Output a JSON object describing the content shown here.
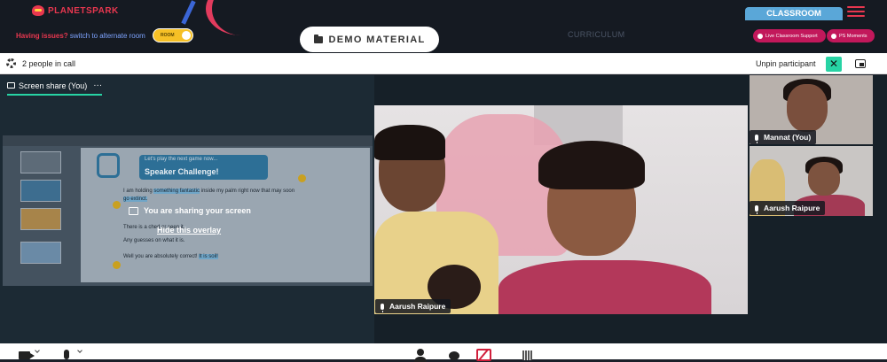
{
  "app": {
    "logo_text": "PLANETSPARK",
    "issue_question": "Having issues?",
    "issue_switch": "switch to alternate room",
    "room_toggle": "ROOM",
    "demo_material": "DEMO MATERIAL",
    "curriculum": "CURRICULUM",
    "classroom_tab": "CLASSROOM",
    "live_support": "Live Classroom Support",
    "ps_moments": "PS Moments"
  },
  "call": {
    "people_count": "2 people in call",
    "unpin_label": "Unpin participant"
  },
  "share": {
    "tab_label": "Screen share (You)",
    "more": "···",
    "overlay_message": "You are sharing your screen",
    "overlay_hide": "Hide this overlay",
    "slide": {
      "title": "Speaker Challenge!",
      "subtitle": "Let's play the next game now...",
      "line1_a": "I am holding ",
      "line1_hl": "something fantastic",
      "line1_b": " inside my palm right now that may soon",
      "line1_hl2": "go extinct.",
      "line2": "There is a                         ched or seen it.",
      "line3": "Any guesses on what it is.",
      "line4_a": "Well you are absolutely correct! ",
      "line4_hl": "It is soil!"
    }
  },
  "participants": [
    {
      "name": "Aarush Raipure"
    },
    {
      "name": "Mannat (You)"
    },
    {
      "name": "Aarush Raipure"
    }
  ],
  "colors": {
    "accent": "#27d3a4",
    "brand_red": "#e8374f",
    "toggle_yellow": "#f6c026",
    "classroom_blue": "#5aa7d8"
  }
}
